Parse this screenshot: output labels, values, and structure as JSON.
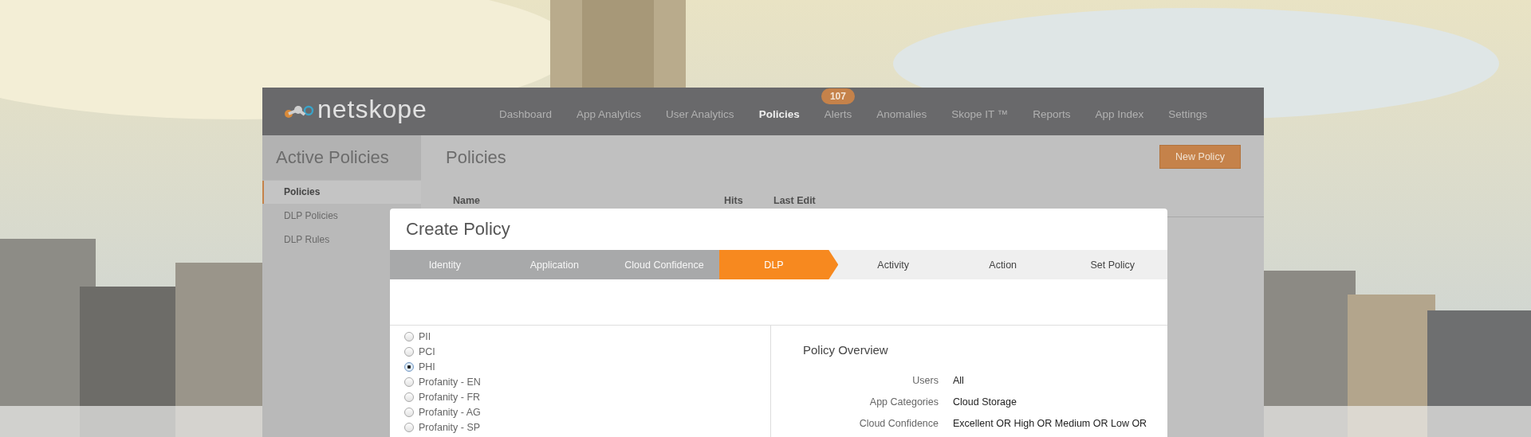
{
  "nav": {
    "logo": "netskope",
    "items": [
      {
        "label": "Dashboard",
        "selected": false
      },
      {
        "label": "App Analytics",
        "selected": false
      },
      {
        "label": "User Analytics",
        "selected": false
      },
      {
        "label": "Policies",
        "selected": true
      },
      {
        "label": "Alerts",
        "selected": false,
        "badge": "107"
      },
      {
        "label": "Anomalies",
        "selected": false
      },
      {
        "label": "Skope IT ™",
        "selected": false
      },
      {
        "label": "Reports",
        "selected": false
      },
      {
        "label": "App Index",
        "selected": false
      },
      {
        "label": "Settings",
        "selected": false
      }
    ]
  },
  "sidebar": {
    "title": "Active Policies",
    "items": [
      {
        "label": "Policies",
        "selected": true
      },
      {
        "label": "DLP Policies",
        "selected": false
      },
      {
        "label": "DLP Rules",
        "selected": false
      }
    ]
  },
  "main": {
    "title": "Policies",
    "button": "New Policy",
    "columns": [
      "Name",
      "Hits",
      "Last Edit"
    ]
  },
  "modal": {
    "title": "Create Policy",
    "steps": [
      {
        "label": "Identity",
        "done": true,
        "selected": false
      },
      {
        "label": "Application",
        "done": true,
        "selected": false
      },
      {
        "label": "Cloud Confidence",
        "done": true,
        "selected": false
      },
      {
        "label": "DLP",
        "done": false,
        "selected": true
      },
      {
        "label": "Activity",
        "done": false,
        "selected": false
      },
      {
        "label": "Action",
        "done": false,
        "selected": false
      },
      {
        "label": "Set Policy",
        "done": false,
        "selected": false
      }
    ],
    "options": [
      {
        "label": "PII",
        "selected": false
      },
      {
        "label": "PCI",
        "selected": false
      },
      {
        "label": "PHI",
        "selected": true
      },
      {
        "label": "Profanity - EN",
        "selected": false
      },
      {
        "label": "Profanity - FR",
        "selected": false
      },
      {
        "label": "Profanity - AG",
        "selected": false
      },
      {
        "label": "Profanity - SP",
        "selected": false
      }
    ],
    "overview": {
      "title": "Policy Overview",
      "rows": [
        {
          "label": "Users",
          "value": "All"
        },
        {
          "label": "App Categories",
          "value": "Cloud Storage"
        },
        {
          "label": "Cloud Confidence",
          "value": "Excellent OR High OR Medium OR Low OR"
        }
      ]
    }
  }
}
